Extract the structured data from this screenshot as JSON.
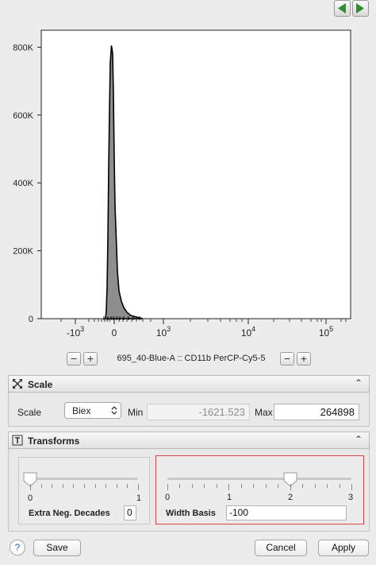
{
  "navigation": {
    "prev_icon": "triangle-left-icon",
    "next_icon": "triangle-right-icon",
    "accent": "#2f8f2f"
  },
  "chart_data": {
    "type": "area",
    "y_ticks": [
      "800K",
      "600K",
      "400K",
      "200K",
      "0"
    ],
    "y_tick_values": [
      800000,
      600000,
      400000,
      200000,
      0
    ],
    "x_major_ticks": [
      {
        "base": "-10",
        "exp": "3"
      },
      {
        "base": "0",
        "exp": ""
      },
      {
        "base": "10",
        "exp": "3"
      },
      {
        "base": "10",
        "exp": "4"
      },
      {
        "base": "10",
        "exp": "5"
      }
    ],
    "peak_value": 800000,
    "fill_color": "#8e8e8e"
  },
  "x_axis": {
    "caption": "695_40-Blue-A :: CD11b PerCP-Cy5-5",
    "minus": "−",
    "plus": "+"
  },
  "scale_panel": {
    "title": "Scale",
    "collapse_glyph": "⌃",
    "scale_label": "Scale",
    "scale_value": "Biex",
    "min_label": "Min",
    "min_value": "-1621.523",
    "max_label": "Max",
    "max_value": "264898"
  },
  "transforms_panel": {
    "title": "Transforms",
    "collapse_glyph": "⌃",
    "extra_slider": {
      "min_label": "0",
      "max_label": "1",
      "value": 0
    },
    "extra_label": "Extra Neg. Decades",
    "extra_value": "0",
    "width_slider": {
      "labels": [
        "0",
        "1",
        "2",
        "3"
      ],
      "value": 2
    },
    "width_label": "Width Basis",
    "width_value": "-100"
  },
  "footer": {
    "help": "?",
    "save": "Save",
    "cancel": "Cancel",
    "apply": "Apply"
  }
}
